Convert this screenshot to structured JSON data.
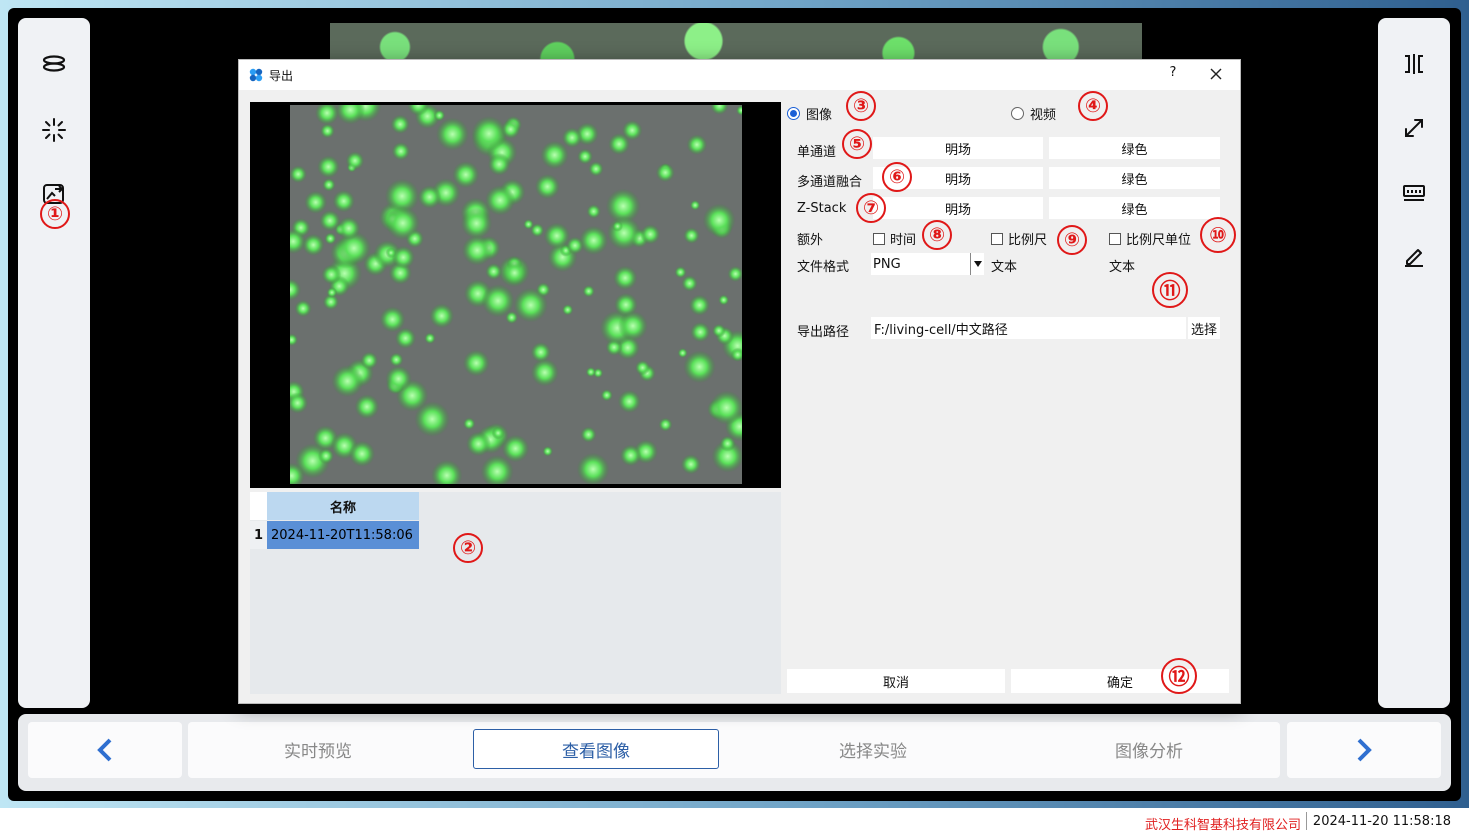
{
  "dialog": {
    "title": "导出",
    "help": "?",
    "list": {
      "header": "名称",
      "rows": [
        {
          "index": "1",
          "name": "2024-11-20T11:58:06"
        }
      ]
    },
    "options": {
      "image_radio": "图像",
      "video_radio": "视频",
      "single_channel_label": "单通道",
      "multi_channel_label": "多通道融合",
      "zstack_label": "Z-Stack",
      "brightfield": "明场",
      "green": "绿色",
      "extra_label": "额外",
      "time_checkbox": "时间",
      "scale_checkbox": "比例尺",
      "scale_unit_checkbox": "比例尺单位",
      "format_label": "文件格式",
      "format_value": "PNG",
      "text_label_1": "文本",
      "text_label_2": "文本",
      "path_label": "导出路径",
      "path_value": "F:/living-cell/中文路径",
      "select_button": "选择",
      "cancel_button": "取消",
      "ok_button": "确定"
    }
  },
  "bottom_nav": {
    "tabs": [
      "实时预览",
      "查看图像",
      "选择实验",
      "图像分析"
    ],
    "active_tab": "查看图像"
  },
  "status": {
    "company": "武汉生科智基科技有限公司",
    "datetime": "2024-11-20 11:58:18"
  },
  "annotations": [
    "①",
    "②",
    "③",
    "④",
    "⑤",
    "⑥",
    "⑦",
    "⑧",
    "⑨",
    "⑩",
    "⑪",
    "⑫"
  ],
  "left_sidebar_icons": [
    "layers-icon",
    "sparkle-icon",
    "export-image-icon"
  ],
  "right_sidebar_icons": [
    "split-view-icon",
    "fullscreen-icon",
    "ruler-icon",
    "edit-icon"
  ],
  "colors": {
    "accent": "#2d5fa6",
    "marker": "#e01818",
    "company": "#e02020",
    "selected_row": "#5a8fd6",
    "header": "#bcd8f0"
  }
}
